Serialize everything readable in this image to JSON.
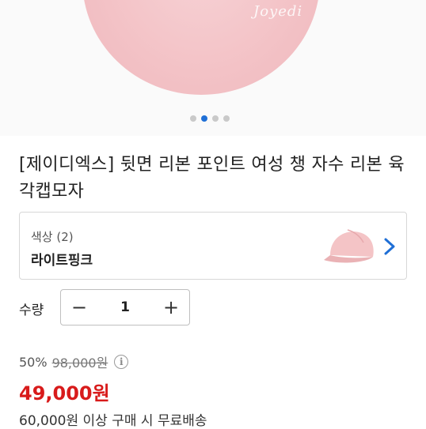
{
  "gallery": {
    "watermark": "Joyedi",
    "dots_total": 4,
    "active_index": 1
  },
  "product": {
    "title": "[제이디엑스] 뒷면 리본 포인트 여성 챙 자수 리본 육각캡모자"
  },
  "option": {
    "label": "색상 (2)",
    "value": "라이트핑크",
    "thumb_icon": "cap-thumbnail",
    "arrow_icon": "chevron-right-icon"
  },
  "quantity": {
    "label": "수량",
    "minus": "−",
    "value": "1",
    "plus": "+"
  },
  "pricing": {
    "discount": "50%",
    "original": "98,000원",
    "info": "i",
    "final": "49,000원",
    "shipping_note": "60,000원 이상 구매 시 무료배송"
  },
  "colors": {
    "accent": "#1f6fd6",
    "price": "#d81b1b",
    "cap": "#f3c2c6"
  }
}
